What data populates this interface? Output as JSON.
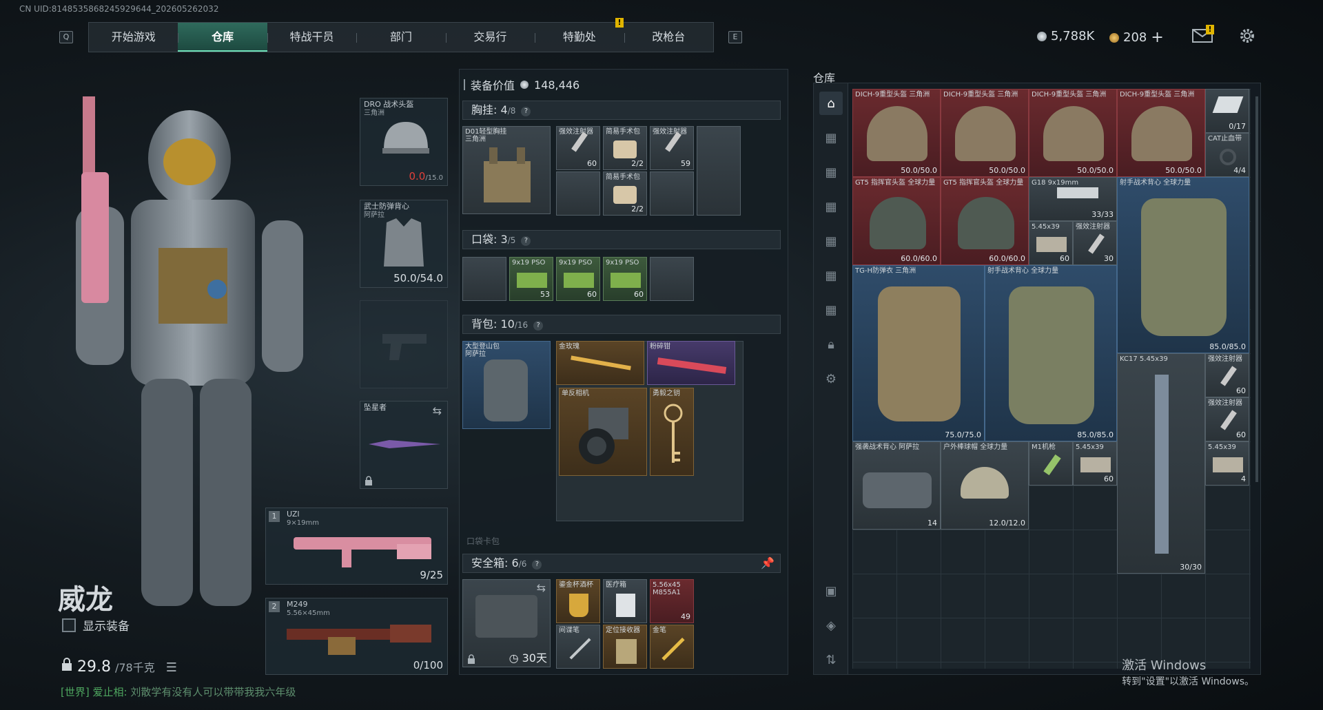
{
  "uid": "CN UID:8148535868245929644_202605262032",
  "nav": {
    "key_left": "Q",
    "key_right": "E",
    "tabs": [
      "开始游戏",
      "仓库",
      "特战干员",
      "部门",
      "交易行",
      "特勤处",
      "改枪台"
    ],
    "active": 1,
    "alert": "!"
  },
  "currency": {
    "silver": "5,788K",
    "gold": "208",
    "plus": "+",
    "mail_alert": "!"
  },
  "character": {
    "name": "威龙",
    "show_equip": "显示装备",
    "weight": "29.8",
    "weight_max": "/78千克"
  },
  "chat": {
    "channel": "[世界]",
    "user": "爱止相:",
    "message": "刘散学有没有人可以带带我我六年级"
  },
  "equip": {
    "helmet": {
      "name": "DRO 战术头盔",
      "sub": "三角洲",
      "dur_cur": "0.0",
      "dur_max": "/15.0"
    },
    "armor": {
      "name": "武士防弹背心",
      "sub": "阿萨拉",
      "dur": "50.0/54.0"
    },
    "melee": {
      "name": "坠星者"
    },
    "primary": {
      "idx": "1",
      "name": "UZI",
      "cal": "9×19mm",
      "ammo": "9/25"
    },
    "secondary": {
      "idx": "2",
      "name": "M249",
      "cal": "5.56×45mm",
      "ammo": "0/100"
    }
  },
  "mid": {
    "value_label": "装备价值",
    "value": "148,446",
    "chest": {
      "label": "胸挂:",
      "count": "4",
      "max": "/8",
      "rig_name": "D01轻型胸挂",
      "rig_sub": "三角洲",
      "items": [
        {
          "label": "强效注射器",
          "count": "60"
        },
        {
          "label": "简易手术包",
          "count": "2/2"
        },
        {
          "label": "强效注射器",
          "count": "59"
        },
        {
          "label": "简易手术包",
          "count": "2/2"
        }
      ]
    },
    "pocket": {
      "label": "口袋:",
      "count": "3",
      "max": "/5",
      "items": [
        {
          "label": "9x19 PSO",
          "count": "53"
        },
        {
          "label": "9x19 PSO",
          "count": "60"
        },
        {
          "label": "9x19 PSO",
          "count": "60"
        }
      ]
    },
    "backpack": {
      "label": "背包:",
      "count": "10",
      "max": "/16",
      "bag_name": "大型登山包",
      "bag_sub": "阿萨拉",
      "items": [
        {
          "label": "金玫瑰"
        },
        {
          "label": "粉碎钳"
        },
        {
          "label": "单反相机"
        },
        {
          "label": "勇毅之钥"
        }
      ]
    },
    "hidden_label": "口袋卡包",
    "safe": {
      "label": "安全箱:",
      "count": "6",
      "max": "/6",
      "days": "30天",
      "items": [
        {
          "label": "鎏金杯酒杯"
        },
        {
          "label": "医疗箱"
        },
        {
          "label": "5.56x45 M855A1",
          "count": "49"
        },
        {
          "label": "间谍笔"
        },
        {
          "label": "定位接收器"
        },
        {
          "label": "金笔"
        }
      ]
    }
  },
  "warehouse": {
    "title": "仓库",
    "items": [
      {
        "label": "DICH-9重型头盔 三角洲",
        "dur": "50.0/50.0"
      },
      {
        "label": "DICH-9重型头盔 三角洲",
        "dur": "50.0/50.0"
      },
      {
        "label": "DICH-9重型头盔 三角洲",
        "dur": "50.0/50.0"
      },
      {
        "label": "DICH-9重型头盔 三角洲",
        "dur": "50.0/50.0"
      },
      {
        "label": "",
        "count": "0/17"
      },
      {
        "label": "CAT止血带",
        "count": "4/4"
      },
      {
        "label": "GT5 指挥官头盔 全球力量",
        "dur": "60.0/60.0"
      },
      {
        "label": "GT5 指挥官头盔 全球力量",
        "dur": "60.0/60.0"
      },
      {
        "label": "G18 9x19mm",
        "count": "33/33"
      },
      {
        "label": "5.45x39",
        "count": "60"
      },
      {
        "label": "强效注射器",
        "count": "30"
      },
      {
        "label": "射手战术背心 全球力量",
        "dur": "85.0/85.0"
      },
      {
        "label": "TG-H防弹衣 三角洲",
        "dur": "75.0/75.0"
      },
      {
        "label": "射手战术背心 全球力量",
        "dur": "85.0/85.0"
      },
      {
        "label": "KC17 5.45x39",
        "count": "30/30"
      },
      {
        "label": "强效注射器",
        "count": "60"
      },
      {
        "label": "强效注射器",
        "count": "60"
      },
      {
        "label": "强袭战术背心 阿萨拉",
        "count": "14"
      },
      {
        "label": "户外棒球帽 全球力量",
        "dur": "12.0/12.0"
      },
      {
        "label": "M1机枪"
      },
      {
        "label": "5.45x39",
        "count": "60"
      },
      {
        "label": "5.45x39",
        "count": "4"
      }
    ]
  },
  "windows": {
    "line1": "激活 Windows",
    "line2": "转到\"设置\"以激活 Windows。"
  }
}
